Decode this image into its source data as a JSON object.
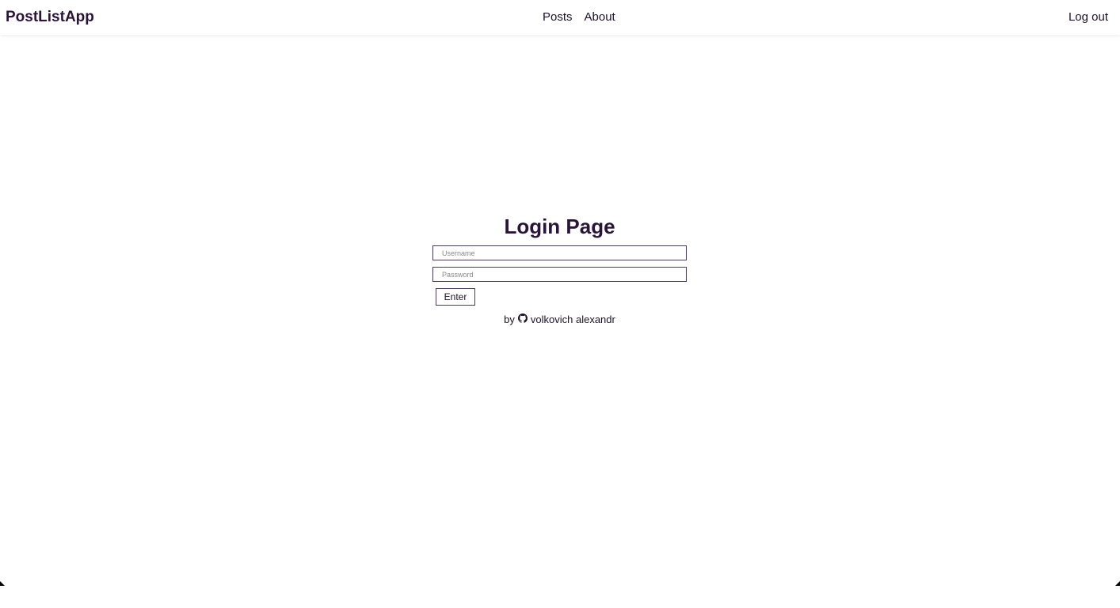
{
  "navbar": {
    "brand": "PostListApp",
    "links": [
      {
        "label": "Posts"
      },
      {
        "label": "About"
      }
    ],
    "logout_label": "Log out"
  },
  "login": {
    "title": "Login Page",
    "username_placeholder": "Username",
    "password_placeholder": "Password",
    "username_value": "",
    "password_value": "",
    "enter_label": "Enter"
  },
  "footer": {
    "by": "by",
    "icon": "github-icon",
    "author": "volkovich alexandr"
  },
  "colors": {
    "accent": "#2a1538"
  }
}
